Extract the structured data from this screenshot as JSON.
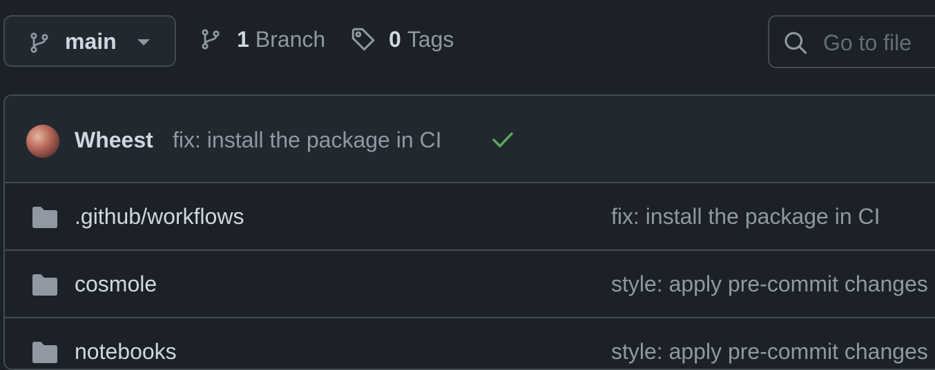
{
  "branch_selector": {
    "label": "main"
  },
  "branches": {
    "count": "1",
    "label": "Branch"
  },
  "tags": {
    "count": "0",
    "label": "Tags"
  },
  "search": {
    "placeholder": "Go to file"
  },
  "latest_commit": {
    "author": "Wheest",
    "message": "fix: install the package in CI",
    "status": "success"
  },
  "files": [
    {
      "name": ".github/workflows",
      "type": "folder",
      "commit_message": "fix: install the package in CI"
    },
    {
      "name": "cosmole",
      "type": "folder",
      "commit_message": "style: apply pre-commit changes"
    },
    {
      "name": "notebooks",
      "type": "folder",
      "commit_message": "style: apply pre-commit changes"
    }
  ],
  "colors": {
    "background": "#1c2128",
    "border": "#454b53",
    "text": "#d1d7e0",
    "muted": "#9198a1",
    "success": "#3fb950",
    "folder": "#9198a1"
  },
  "icons": {
    "branch": "git-branch-icon",
    "caret": "triangle-down-icon",
    "tag": "tag-icon",
    "search": "search-icon",
    "check": "check-icon",
    "folder": "folder-icon"
  }
}
